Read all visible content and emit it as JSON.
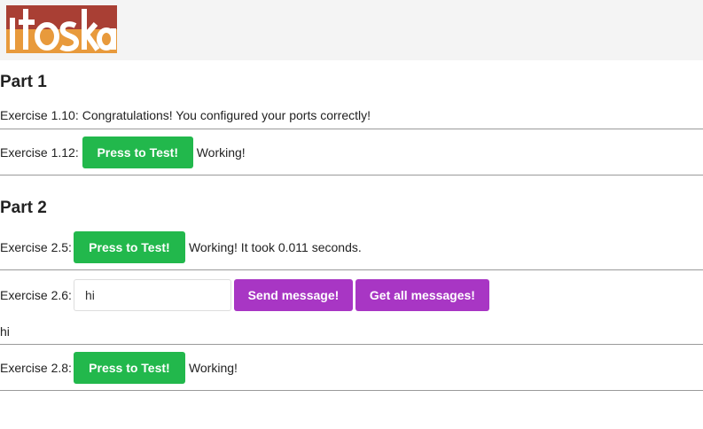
{
  "logo": {
    "text": "itoska",
    "colors": {
      "top": "#a93f34",
      "bottom": "#e89a3c"
    }
  },
  "part1": {
    "title": "Part 1",
    "ex110": {
      "label": "Exercise 1.10:",
      "message": "Congratulations! You configured your ports correctly!"
    },
    "ex112": {
      "label": "Exercise 1.12:",
      "button": "Press to Test!",
      "status": "Working!"
    }
  },
  "part2": {
    "title": "Part 2",
    "ex25": {
      "label": "Exercise 2.5:",
      "button": "Press to Test!",
      "status": "Working! It took 0.011 seconds."
    },
    "ex26": {
      "label": "Exercise 2.6:",
      "input_value": "hi",
      "send_button": "Send message!",
      "get_button": "Get all messages!",
      "messages": [
        "hi"
      ]
    },
    "ex28": {
      "label": "Exercise 2.8:",
      "button": "Press to Test!",
      "status": "Working!"
    }
  },
  "colors": {
    "green_button": "#22b84c",
    "purple_button": "#a836c4"
  }
}
